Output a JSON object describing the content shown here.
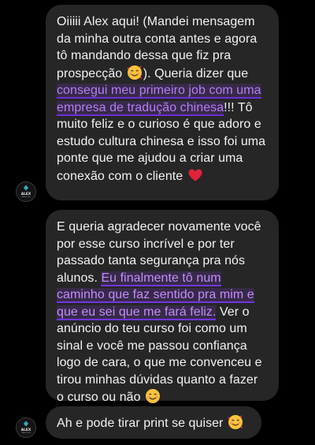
{
  "messages": [
    {
      "segments": [
        {
          "text": "Oiiiii Alex aqui! (Mandei mensagem da minha outra conta antes e agora tô mandando dessa que fiz pra prospecção "
        },
        {
          "emoji": "smiling-face-with-hearts"
        },
        {
          "text": "). Queria dizer que "
        },
        {
          "text": "consegui meu primeiro job com uma empresa de tradução chinesa",
          "highlight": true
        },
        {
          "text": "!!! Tô muito feliz e o curioso é que adoro e estudo cultura chinesa e isso foi uma ponte que me ajudou a criar uma conexão com o cliente "
        },
        {
          "emoji": "red-heart"
        }
      ]
    },
    {
      "segments": [
        {
          "text": "E queria agradecer novamente você por esse curso incrível e por ter passado tanta segurança pra nós alunos. "
        },
        {
          "text": "Eu finalmente tô num caminho que faz sentido pra mim e que eu sei que me fará feliz.",
          "highlight": true
        },
        {
          "text": " Ver o anúncio do teu curso foi como um sinal e você me passou confiança logo de cara, o que me convenceu e tirou minhas dúvidas quanto a fazer o curso ou não "
        },
        {
          "emoji": "smiling-face"
        }
      ]
    },
    {
      "segments": [
        {
          "text": "Ah e pode tirar print se quiser "
        },
        {
          "emoji": "smiling-face-with-hearts"
        }
      ]
    }
  ],
  "avatar": {
    "label": "ALEX",
    "sublabel": "TRADUÇÕES"
  },
  "colors": {
    "bubble": "#262626",
    "text": "#f2f2f2",
    "highlight": "#b77cf7",
    "background": "#000000"
  }
}
